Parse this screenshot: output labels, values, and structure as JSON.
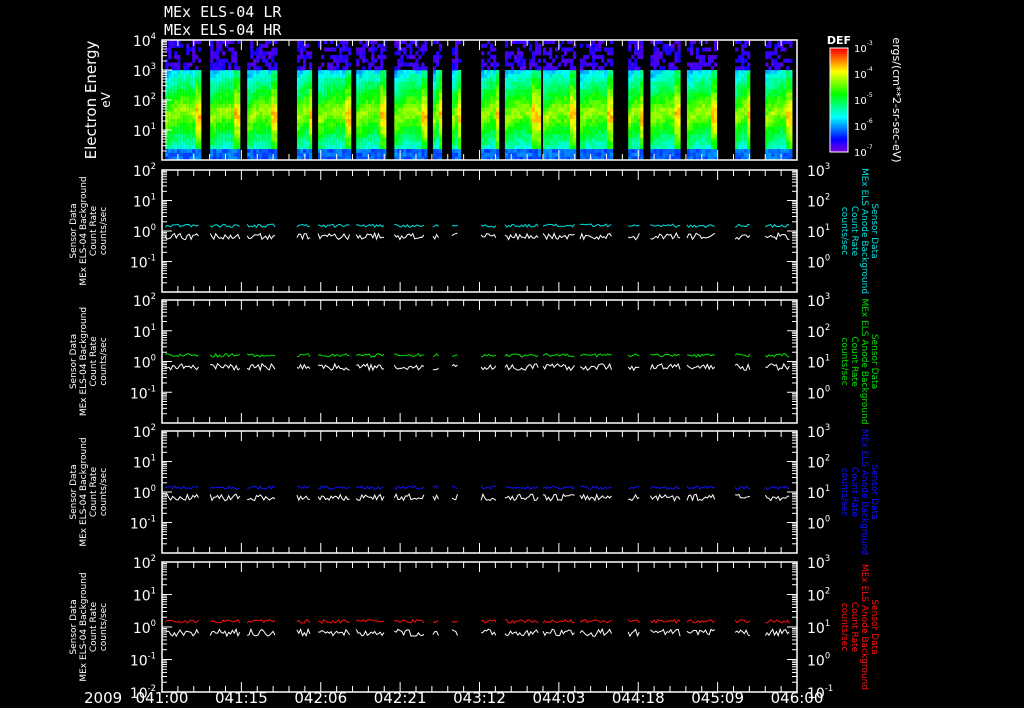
{
  "chart_data": {
    "type": "heatmap+line",
    "titles": [
      "MEx ELS-04 LR",
      "MEx ELS-04 HR"
    ],
    "x_axis": {
      "year_label": "2009",
      "tick_labels": [
        "041:00",
        "041:15",
        "042:06",
        "042:21",
        "043:12",
        "044:03",
        "044:18",
        "045:09",
        "046:00"
      ],
      "range_hours": [
        0,
        120
      ],
      "tick_step_hours": 15
    },
    "data_segments_hours": [
      [
        0.6,
        7.2
      ],
      [
        9.1,
        14.7
      ],
      [
        16.1,
        21.4
      ],
      [
        25.5,
        28
      ],
      [
        29.5,
        35.5
      ],
      [
        36.7,
        42.2
      ],
      [
        43.9,
        49.7
      ],
      [
        51.2,
        52.5
      ],
      [
        54.8,
        56
      ],
      [
        60.3,
        63.3
      ],
      [
        64.8,
        71.1
      ],
      [
        72,
        78.1
      ],
      [
        79,
        85.1
      ],
      [
        88.1,
        90.4
      ],
      [
        92.3,
        97.9
      ],
      [
        99.2,
        104.5
      ],
      [
        108.3,
        111.1
      ],
      [
        114,
        118.7
      ]
    ],
    "spectrogram": {
      "ylabel": "Electron Energy",
      "yunit": "eV",
      "ylim_exp": [
        0,
        4
      ],
      "tick_labels": [
        {
          "base": "10",
          "exp": "4"
        },
        {
          "base": "10",
          "exp": "3"
        },
        {
          "base": "10",
          "exp": "2"
        },
        {
          "base": "10",
          "exp": "1"
        }
      ],
      "colorbar": {
        "title": "DEF",
        "unit": "ergs/(cm**2-sr-sec-eV)",
        "ticks": [
          {
            "base": "10",
            "exp": "-3"
          },
          {
            "base": "10",
            "exp": "-4"
          },
          {
            "base": "10",
            "exp": "-5"
          },
          {
            "base": "10",
            "exp": "-6"
          },
          {
            "base": "10",
            "exp": "-7"
          }
        ]
      }
    },
    "line_panels": [
      {
        "color": "#00e0e0",
        "left_label": [
          "Sensor Data",
          "MEx ELS-04 Background",
          "Count Rate",
          "counts/sec"
        ],
        "right_label": [
          "Sensor Data",
          "MEx ELS Anode Background",
          "Count Rate",
          "counts/sec"
        ],
        "anode_level": 1.5,
        "sensor_level": 0.7
      },
      {
        "color": "#00e000",
        "left_label": [
          "Sensor Data",
          "MEx ELS-04 Background",
          "Count Rate",
          "counts/sec"
        ],
        "right_label": [
          "Sensor Data",
          "MEx ELS Anode Background",
          "Count Rate",
          "counts/sec"
        ],
        "anode_level": 1.6,
        "sensor_level": 0.7
      },
      {
        "color": "#1010ff",
        "left_label": [
          "Sensor Data",
          "MEx ELS-04 Background",
          "Count Rate",
          "counts/sec"
        ],
        "right_label": [
          "Sensor Data",
          "MEx ELS Anode Background",
          "Count Rate",
          "counts/sec"
        ],
        "anode_level": 1.4,
        "sensor_level": 0.7
      },
      {
        "color": "#ff1010",
        "left_label": [
          "Sensor Data",
          "MEx ELS-04 Background",
          "Count Rate",
          "counts/sec"
        ],
        "right_label": [
          "Sensor Data",
          "MEx ELS Anode Background",
          "Count Rate",
          "counts/sec"
        ],
        "anode_level": 1.5,
        "sensor_level": 0.7
      }
    ],
    "left_ylim_exp": [
      -2,
      2
    ],
    "right_ylim_exp": [
      -1,
      3
    ]
  }
}
